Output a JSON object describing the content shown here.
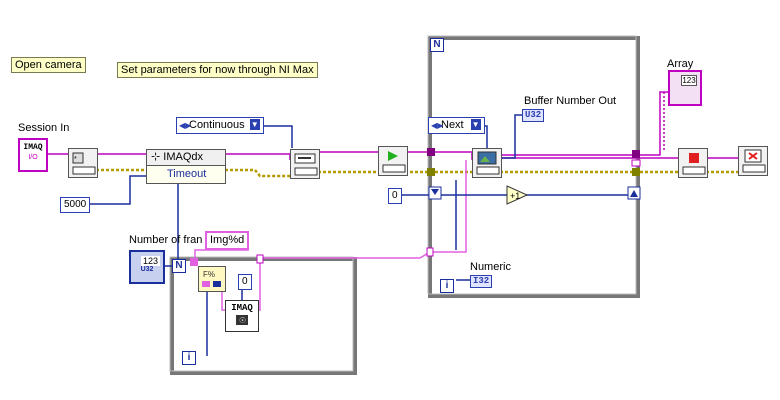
{
  "comments": {
    "open_camera": "Open camera",
    "set_params": "Set parameters for now through NI Max"
  },
  "labels": {
    "session_in": "Session In",
    "number_of_frames": "Number of fran",
    "buffer_number_out": "Buffer Number Out",
    "numeric": "Numeric",
    "array": "Array"
  },
  "property_node": {
    "class": "IMAQdx",
    "property": "Timeout"
  },
  "constants": {
    "timeout_value": "5000",
    "zero_inner": "0",
    "zero_outer": "0",
    "format_string": "Img%d"
  },
  "enums": {
    "acquisition_mode": "Continuous",
    "buffer_mode": "Next"
  },
  "terminals": {
    "loop_count": "N",
    "iteration": "i",
    "session_in_text": "IMAQ",
    "session_in_type": "I/O",
    "frames_type": "U32",
    "frames_ctrl": "123",
    "buffer_out_type": "U32",
    "numeric_type": "I32",
    "array_ctrl": "123",
    "imaq_create_text": "IMAQ"
  },
  "colors": {
    "wire_image": "#c000c0",
    "wire_error": "#b59a00",
    "wire_numeric": "#1a2e9c",
    "loop_border": "#888888",
    "comment_bg": "#ffffc8"
  }
}
